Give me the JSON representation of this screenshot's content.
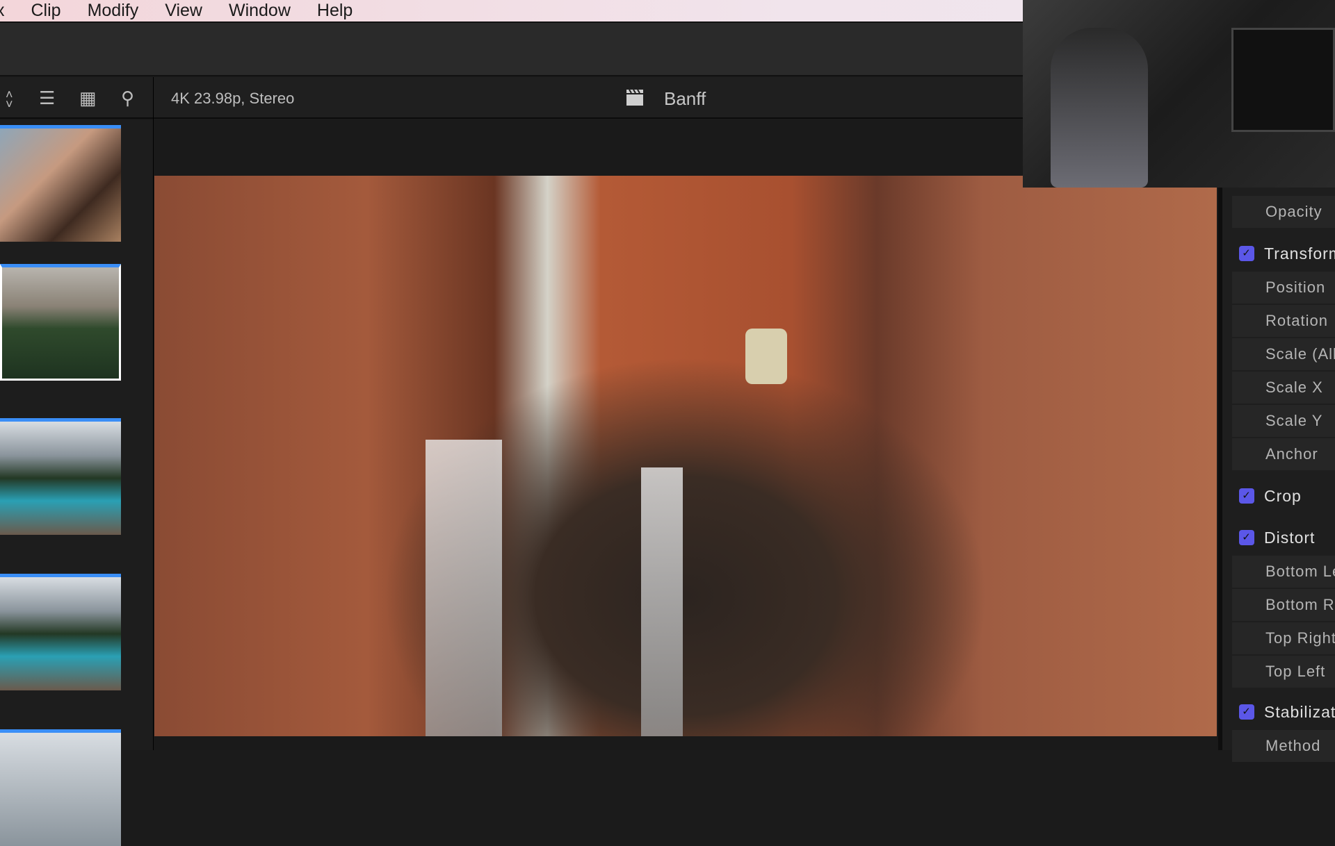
{
  "menubar": {
    "items": [
      "x",
      "Clip",
      "Modify",
      "View",
      "Window",
      "Help"
    ]
  },
  "toolbar": {
    "format": "4K 23.98p, Stereo",
    "project_title": "Banff",
    "icons": [
      "chevron-updown-icon",
      "list-view-icon",
      "filmstrip-icon",
      "search-icon",
      "clapper-icon"
    ]
  },
  "browser": {
    "thumbnails": [
      "couple-portrait",
      "mountain-forest",
      "lake-pines-1",
      "lake-pines-2",
      "lake-pines-3"
    ]
  },
  "inspector": {
    "opacity": "Opacity",
    "sections": [
      {
        "label": "Transform",
        "checked": true,
        "params": [
          "Position",
          "Rotation",
          "Scale (All)",
          "Scale X",
          "Scale Y",
          "Anchor"
        ]
      },
      {
        "label": "Crop",
        "checked": true,
        "params": []
      },
      {
        "label": "Distort",
        "checked": true,
        "params": [
          "Bottom Left",
          "Bottom Right",
          "Top Right",
          "Top Left"
        ]
      },
      {
        "label": "Stabilization",
        "checked": true,
        "params": [
          "Method"
        ]
      }
    ]
  },
  "colors": {
    "accent": "#5b57e8",
    "selection": "#3a8ef6"
  }
}
